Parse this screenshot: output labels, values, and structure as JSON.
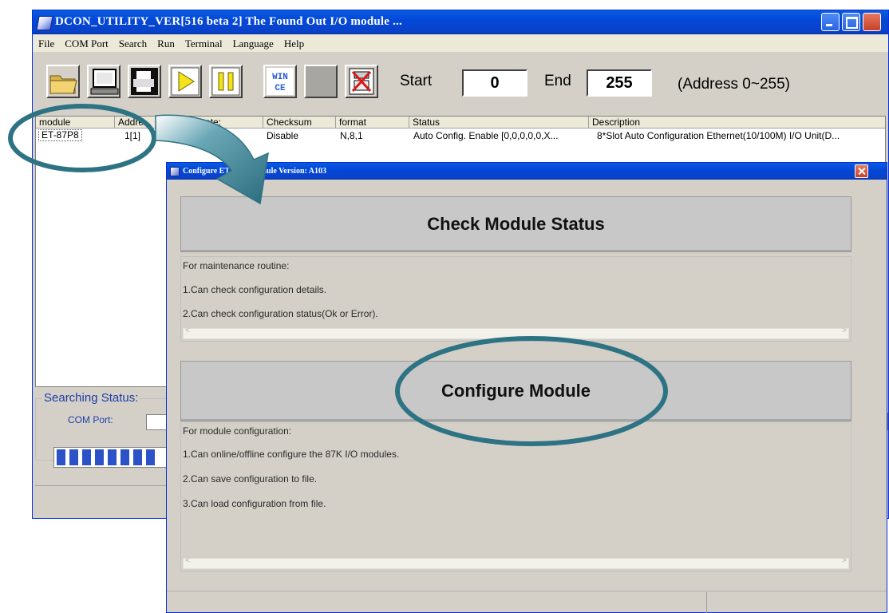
{
  "window": {
    "title": "DCON_UTILITY_VER[516 beta 2] The Found Out I/O module ..."
  },
  "menu": [
    "File",
    "COM Port",
    "Search",
    "Run",
    "Terminal",
    "Language",
    "Help"
  ],
  "toolbar": {
    "wince_label": "WIN\nCE",
    "start_label": "Start",
    "start_value": "0",
    "end_label": "End",
    "end_value": "255",
    "range_text": "(Address 0~255)"
  },
  "table": {
    "headers": [
      "module",
      "Addre",
      "Baudrate:",
      "Checksum",
      "format",
      "Status",
      "Description"
    ],
    "rows": [
      [
        "ET-87P8",
        "1[1]",
        "",
        "Disable",
        "N,8,1",
        "Auto Config. Enable [0,0,0,0,0,X...",
        "8*Slot Auto Configuration Ethernet(10/100M) I/O Unit(D..."
      ]
    ]
  },
  "search": {
    "title": "Searching Status:",
    "com_port_label": "COM Port:",
    "progress_segments": 8
  },
  "dialog": {
    "title": "Configure ET-87P8 Module Version: A103",
    "check_button": "Check Module Status",
    "check_lines": [
      "For maintenance routine:",
      "1.Can check configuration details.",
      "2.Can check configuration status(Ok or Error)."
    ],
    "configure_button": "Configure Module",
    "configure_lines": [
      "For module configuration:",
      "1.Can online/offline configure the 87K I/O modules.",
      "2.Can save configuration to file.",
      "3.Can load configuration from file."
    ]
  },
  "colors": {
    "titlebar": "#0348d8",
    "annotation": "#2e7384",
    "window_bg": "#d4d0c8",
    "progress": "#2b52c6"
  }
}
